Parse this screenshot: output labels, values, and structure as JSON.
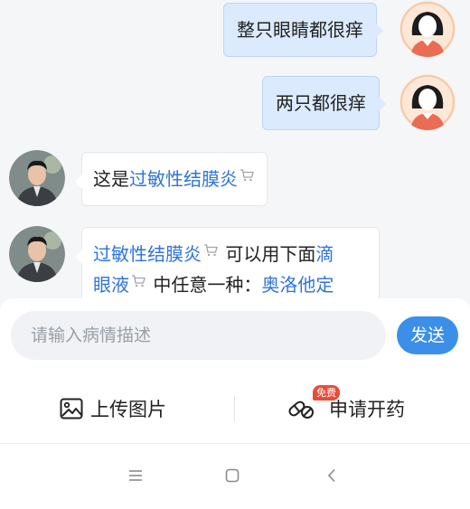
{
  "chat": {
    "messages": [
      {
        "sender": "user",
        "text": "整只眼睛都很痒"
      },
      {
        "sender": "user",
        "text": "两只都很痒"
      },
      {
        "sender": "doctor",
        "prefix": "这是",
        "link": "过敏性结膜炎"
      },
      {
        "sender": "doctor",
        "link1": "过敏性结膜炎",
        "mid1": " 可以用下面",
        "link2a": "滴",
        "link2b": "眼液",
        "mid2": " 中任意一种：",
        "link3": "奥洛他定"
      }
    ]
  },
  "input": {
    "placeholder": "请输入病情描述",
    "send_label": "发送"
  },
  "actions": {
    "upload_label": "上传图片",
    "prescribe_label": "申请开药",
    "badge": "免费"
  },
  "colors": {
    "accent": "#3b8fe8",
    "link": "#2f74d8",
    "user_bubble": "#dbeafd",
    "badge": "#e94b3c"
  },
  "icons": [
    "avatar-user",
    "avatar-doctor",
    "cart-icon",
    "image-upload-icon",
    "pill-icon",
    "menu-icon",
    "home-icon",
    "back-icon"
  ]
}
